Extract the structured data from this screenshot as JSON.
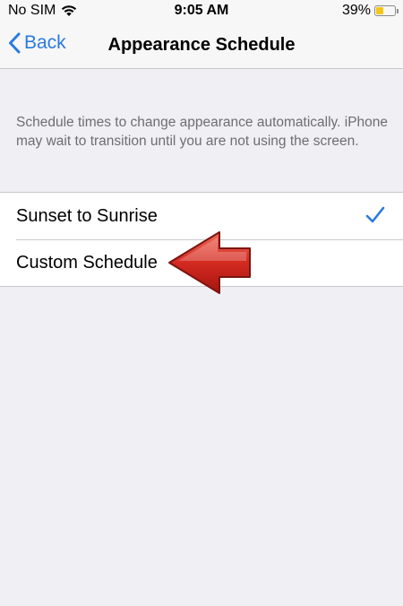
{
  "status_bar": {
    "carrier": "No SIM",
    "time": "9:05 AM",
    "battery_percent": "39%",
    "battery_level": 0.39,
    "battery_color": "#f5c518"
  },
  "nav": {
    "back_label": "Back",
    "title": "Appearance Schedule",
    "accent_color": "#2a7ae2"
  },
  "description": "Schedule times to change appearance automatically. iPhone may wait to transition until you are not using the screen.",
  "options": [
    {
      "label": "Sunset to Sunrise",
      "selected": true
    },
    {
      "label": "Custom Schedule",
      "selected": false
    }
  ],
  "annotation": {
    "icon": "red-arrow-left-icon",
    "color": "#d42a20"
  }
}
